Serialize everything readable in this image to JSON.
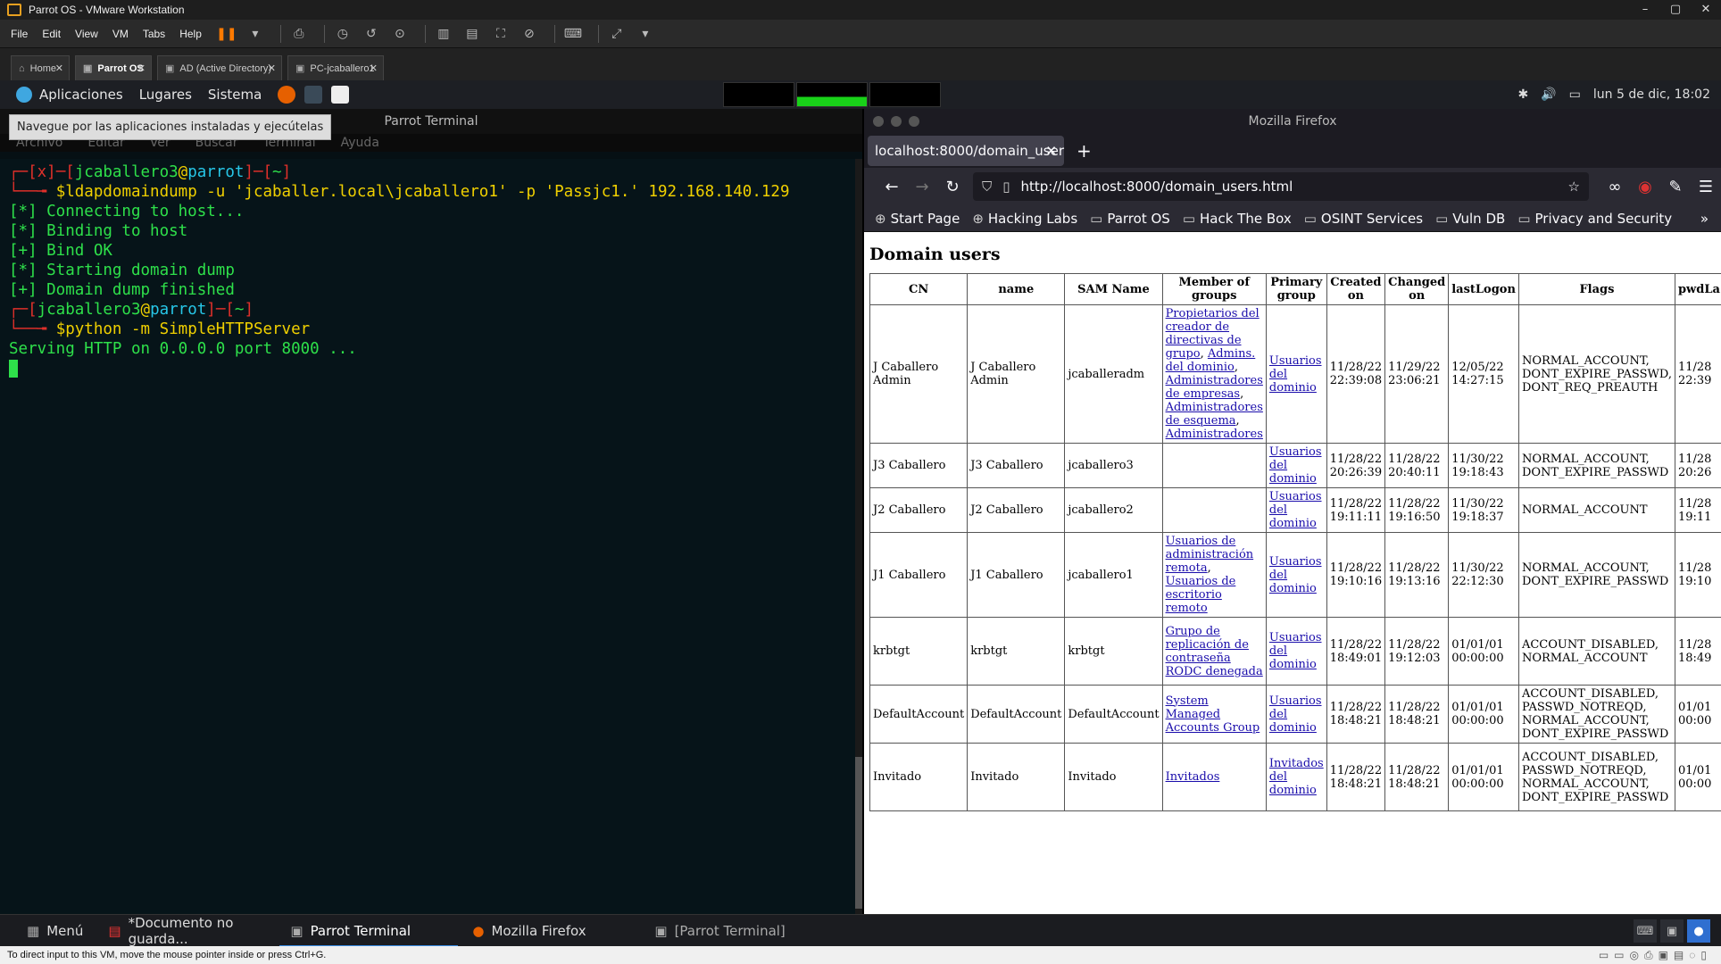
{
  "vmware": {
    "title": "Parrot OS - VMware Workstation",
    "menu": [
      "File",
      "Edit",
      "View",
      "VM",
      "Tabs",
      "Help"
    ],
    "tabs": [
      {
        "label": "Home"
      },
      {
        "label": "Parrot OS"
      },
      {
        "label": "AD (Active Directory)"
      },
      {
        "label": "PC-jcaballero1"
      }
    ],
    "status_text": "To direct input to this VM, move the mouse pointer inside or press Ctrl+G."
  },
  "panel": {
    "apps": "Aplicaciones",
    "places": "Lugares",
    "system": "Sistema",
    "clock": "lun  5 de dic, 18:02",
    "tooltip": "Navegue por las aplicaciones instaladas y ejecútelas"
  },
  "terminal": {
    "title": "Parrot Terminal",
    "menu": [
      "Archivo",
      "Editar",
      "Ver",
      "Buscar",
      "Terminal",
      "Ayuda"
    ],
    "prompt1_user": "jcaballero3",
    "prompt1_host": "parrot",
    "prompt1_mark": "x",
    "prompt1_dir": "~",
    "cmd1": "$ldapdomaindump -u 'jcaballer.local\\jcaballero1' -p 'Passjc1.' 192.168.140.129",
    "out": [
      "[*] Connecting to host...",
      "[*] Binding to host",
      "[+] Bind OK",
      "[*] Starting domain dump",
      "[+] Domain dump finished"
    ],
    "prompt2_user": "jcaballero3",
    "prompt2_host": "parrot",
    "prompt2_dir": "~",
    "cmd2": "$python -m SimpleHTTPServer",
    "serving": "Serving HTTP on 0.0.0.0 port 8000 ..."
  },
  "firefox": {
    "title": "Mozilla Firefox",
    "tab_label": "localhost:8000/domain_user",
    "url": "http://localhost:8000/domain_users.html",
    "bookmarks": [
      "Start Page",
      "Hacking Labs",
      "Parrot OS",
      "Hack The Box",
      "OSINT Services",
      "Vuln DB",
      "Privacy and Security"
    ],
    "page_title": "Domain users",
    "columns": [
      "CN",
      "name",
      "SAM Name",
      "Member of groups",
      "Primary group",
      "Created on",
      "Changed on",
      "lastLogon",
      "Flags",
      "pwdLa"
    ],
    "rows": [
      {
        "cn": "J Caballero Admin",
        "name": "J Caballero Admin",
        "sam": "jcaballeradm",
        "groups": [
          "Propietarios del creador de directivas de grupo",
          "Admins. del dominio",
          "Administradores de empresas",
          "Administradores de esquema",
          "Administradores"
        ],
        "primary": "Usuarios del dominio",
        "created": "11/28/22 22:39:08",
        "changed": "11/29/22 23:06:21",
        "lastlogon": "12/05/22 14:27:15",
        "flags": "NORMAL_ACCOUNT, DONT_EXPIRE_PASSWD, DONT_REQ_PREAUTH",
        "pwd": "11/28 22:39"
      },
      {
        "cn": "J3 Caballero",
        "name": "J3 Caballero",
        "sam": "jcaballero3",
        "groups": [],
        "primary": "Usuarios del dominio",
        "created": "11/28/22 20:26:39",
        "changed": "11/28/22 20:40:11",
        "lastlogon": "11/30/22 19:18:43",
        "flags": "NORMAL_ACCOUNT, DONT_EXPIRE_PASSWD",
        "pwd": "11/28 20:26"
      },
      {
        "cn": "J2 Caballero",
        "name": "J2 Caballero",
        "sam": "jcaballero2",
        "groups": [],
        "primary": "Usuarios del dominio",
        "created": "11/28/22 19:11:11",
        "changed": "11/28/22 19:16:50",
        "lastlogon": "11/30/22 19:18:37",
        "flags": "NORMAL_ACCOUNT",
        "pwd": "11/28 19:11"
      },
      {
        "cn": "J1 Caballero",
        "name": "J1 Caballero",
        "sam": "jcaballero1",
        "groups": [
          "Usuarios de administración remota",
          "Usuarios de escritorio remoto"
        ],
        "primary": "Usuarios del dominio",
        "created": "11/28/22 19:10:16",
        "changed": "11/28/22 19:13:16",
        "lastlogon": "11/30/22 22:12:30",
        "flags": "NORMAL_ACCOUNT, DONT_EXPIRE_PASSWD",
        "pwd": "11/28 19:10"
      },
      {
        "cn": "krbtgt",
        "name": "krbtgt",
        "sam": "krbtgt",
        "groups": [
          "Grupo de replicación de contraseña RODC denegada"
        ],
        "primary": "Usuarios del dominio",
        "created": "11/28/22 18:49:01",
        "changed": "11/28/22 19:12:03",
        "lastlogon": "01/01/01 00:00:00",
        "flags": "ACCOUNT_DISABLED, NORMAL_ACCOUNT",
        "pwd": "11/28 18:49"
      },
      {
        "cn": "DefaultAccount",
        "name": "DefaultAccount",
        "sam": "DefaultAccount",
        "groups": [
          "System Managed Accounts Group"
        ],
        "primary": "Usuarios del dominio",
        "created": "11/28/22 18:48:21",
        "changed": "11/28/22 18:48:21",
        "lastlogon": "01/01/01 00:00:00",
        "flags": "ACCOUNT_DISABLED, PASSWD_NOTREQD, NORMAL_ACCOUNT, DONT_EXPIRE_PASSWD",
        "pwd": "01/01 00:00"
      },
      {
        "cn": "Invitado",
        "name": "Invitado",
        "sam": "Invitado",
        "groups": [
          "Invitados"
        ],
        "primary": "Invitados del dominio",
        "created": "11/28/22 18:48:21",
        "changed": "11/28/22 18:48:21",
        "lastlogon": "01/01/01 00:00:00",
        "flags": "ACCOUNT_DISABLED, PASSWD_NOTREQD, NORMAL_ACCOUNT, DONT_EXPIRE_PASSWD",
        "pwd": "01/01 00:00"
      }
    ]
  },
  "taskbar": {
    "menu": "Menú",
    "items": [
      "*Documento no guarda...",
      "Parrot Terminal",
      "Mozilla Firefox",
      "[Parrot Terminal]"
    ]
  }
}
